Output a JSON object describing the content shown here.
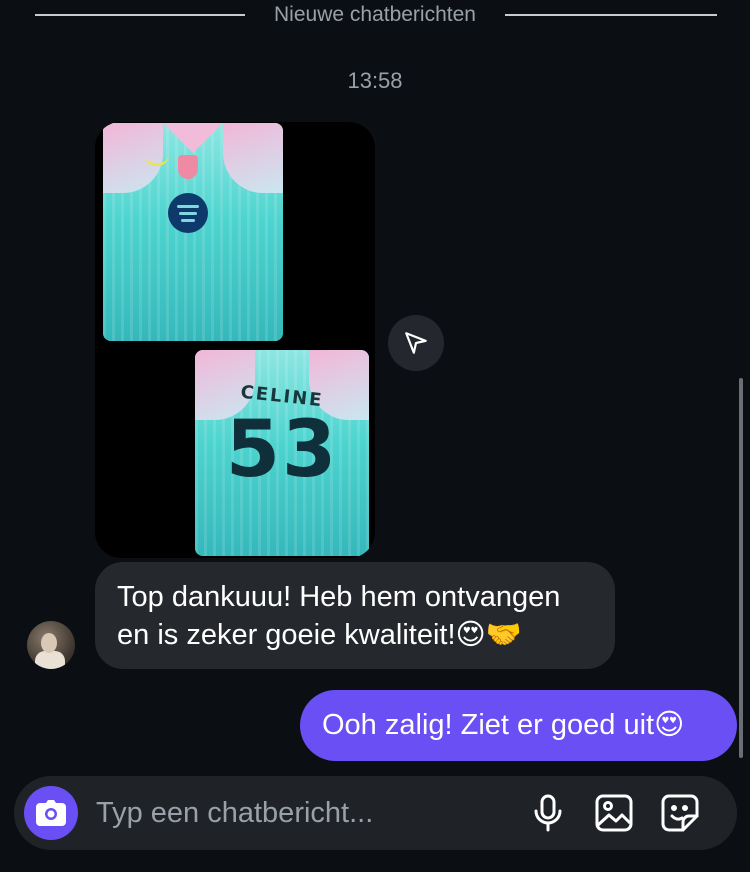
{
  "divider": {
    "label": "Nieuwe chatberichten"
  },
  "timestamp": "13:58",
  "shared_photo": {
    "back_name": "CELINE",
    "back_number": "53"
  },
  "incoming_message": {
    "text": "Top dankuuu! Heb hem ontvangen en is zeker goeie kwaliteit!😍🤝"
  },
  "outgoing_message": {
    "text": "Ooh zalig! Ziet er goed uit😍"
  },
  "composer": {
    "placeholder": "Typ een chatbericht..."
  },
  "icons": {
    "share": "paper-plane-icon",
    "camera": "camera-icon",
    "mic": "microphone-icon",
    "gallery": "image-gallery-icon",
    "sticker": "sticker-icon"
  },
  "colors": {
    "background": "#0b0f14",
    "incoming_bubble": "#25282d",
    "outgoing_bubble": "#6a4ff5",
    "accent": "#6a4ff5"
  }
}
